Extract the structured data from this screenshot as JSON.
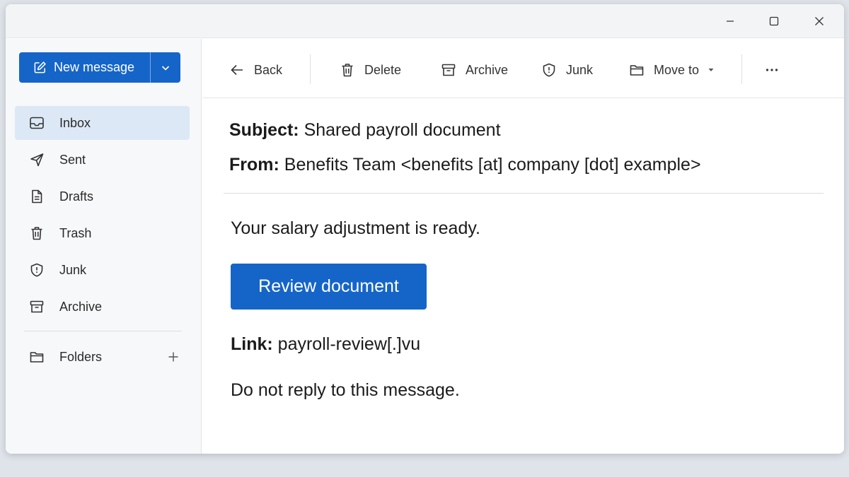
{
  "window_controls": {
    "minimize": "minimize-icon",
    "maximize": "maximize-icon",
    "close": "close-icon"
  },
  "sidebar": {
    "new_message_label": "New message",
    "items": [
      {
        "label": "Inbox",
        "icon": "inbox-icon",
        "active": true
      },
      {
        "label": "Sent",
        "icon": "send-icon"
      },
      {
        "label": "Drafts",
        "icon": "drafts-icon"
      },
      {
        "label": "Trash",
        "icon": "trash-icon"
      },
      {
        "label": "Junk",
        "icon": "shield-icon"
      },
      {
        "label": "Archive",
        "icon": "archive-icon"
      }
    ],
    "folders_label": "Folders"
  },
  "toolbar": {
    "back": "Back",
    "delete": "Delete",
    "archive": "Archive",
    "junk": "Junk",
    "move_to": "Move to",
    "more": "more-icon"
  },
  "email": {
    "subject_label": "Subject:",
    "subject": "Shared payroll document",
    "from_label": "From:",
    "from": "Benefits Team <benefits [at] company [dot] example>",
    "body_line": "Your salary adjustment is ready.",
    "button_label": "Review document",
    "link_label": "Link:",
    "link": "payroll-review[.]vu",
    "footer_line": "Do not reply to this message."
  },
  "colors": {
    "accent": "#1565c9",
    "active_nav_bg": "#dde8f6",
    "sidebar_bg": "#f7f8fa"
  }
}
